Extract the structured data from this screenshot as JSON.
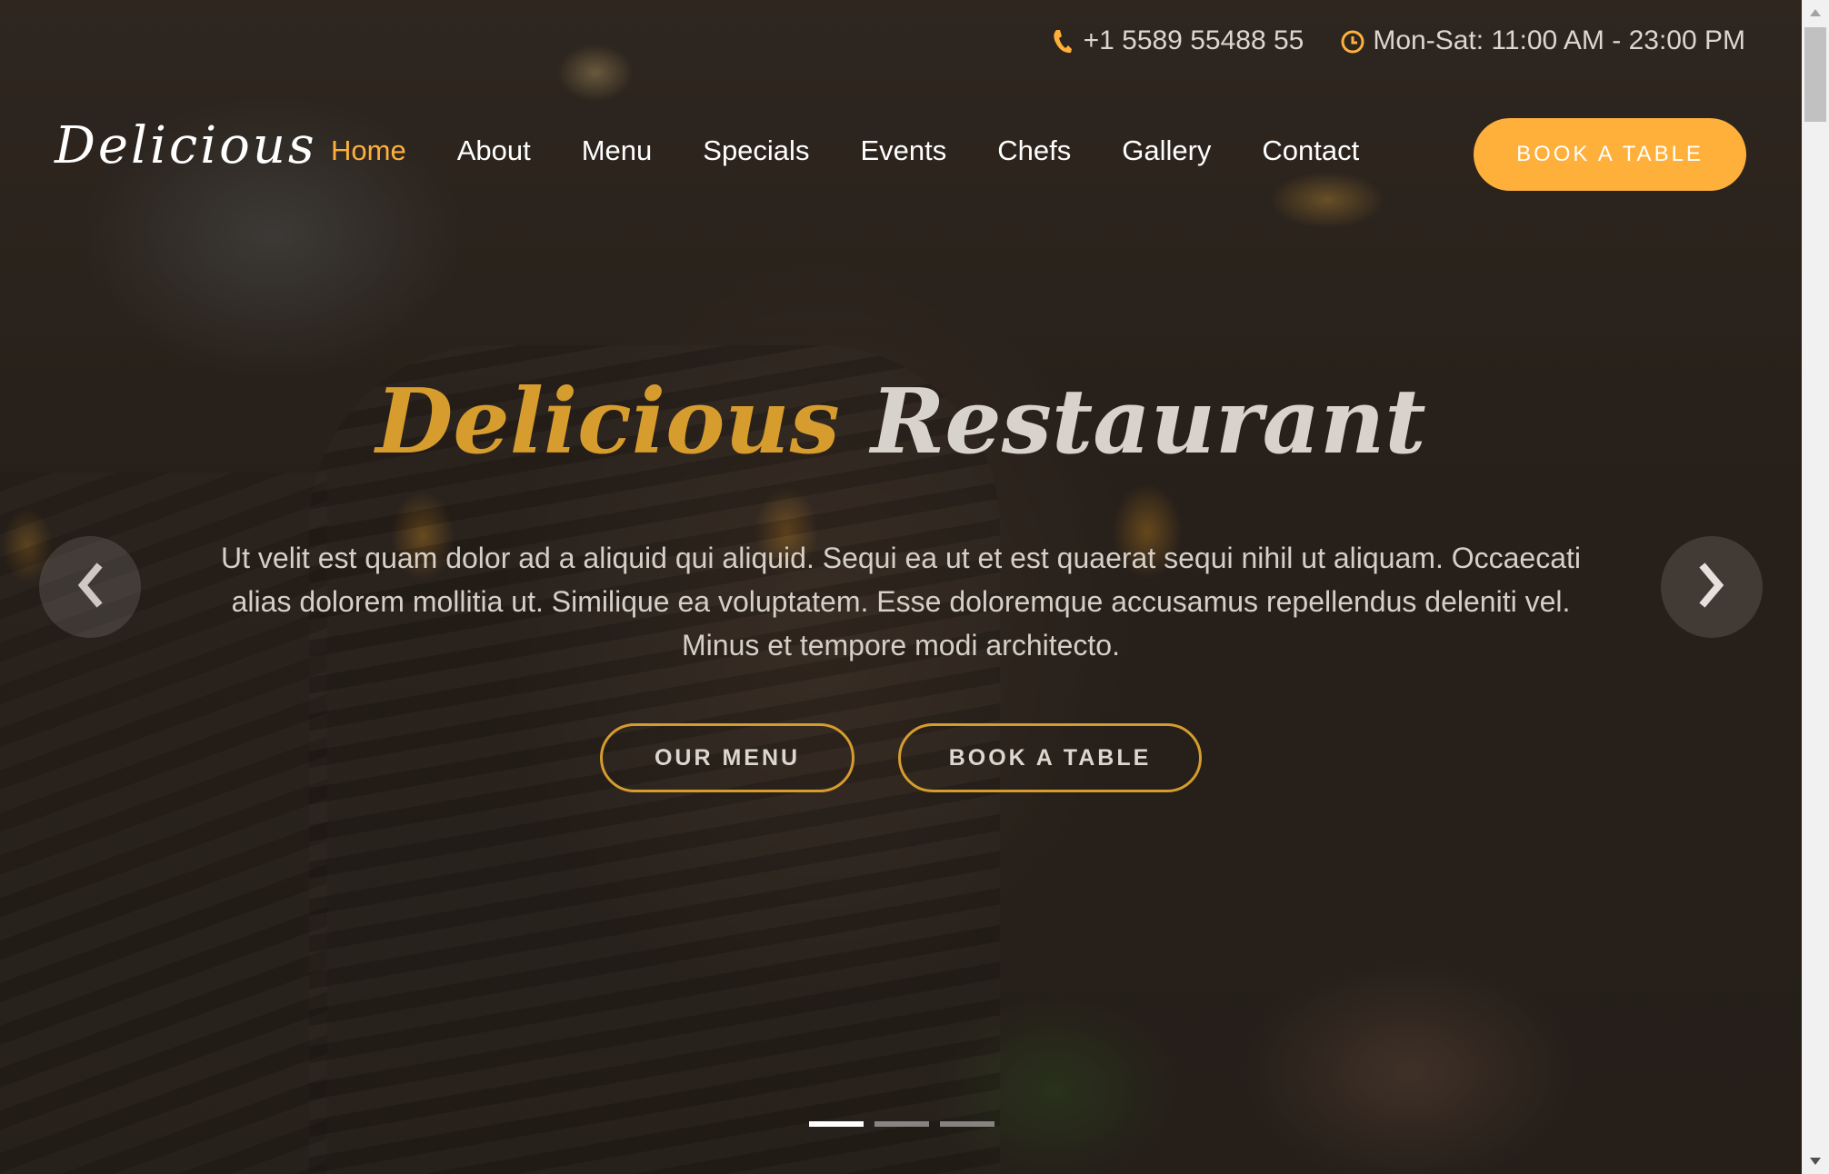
{
  "topbar": {
    "phone": "+1 5589 55488 55",
    "hours": "Mon-Sat: 11:00 AM - 23:00 PM",
    "phone_icon": "phone-icon",
    "clock_icon": "clock-icon"
  },
  "header": {
    "logo": "Delicious",
    "nav": [
      {
        "label": "Home",
        "active": true
      },
      {
        "label": "About"
      },
      {
        "label": "Menu"
      },
      {
        "label": "Specials"
      },
      {
        "label": "Events"
      },
      {
        "label": "Chefs"
      },
      {
        "label": "Gallery"
      },
      {
        "label": "Contact"
      }
    ],
    "cta_label": "BOOK A TABLE"
  },
  "hero": {
    "title_part1": "Delicious",
    "title_part2": "Restaurant",
    "text": "Ut velit est quam dolor ad a aliquid qui aliquid. Sequi ea ut et est quaerat sequi nihil ut aliquam. Occaecati alias dolorem mollitia ut. Similique ea voluptatem. Esse doloremque accusamus repellendus deleniti vel. Minus et tempore modi architecto.",
    "btn_menu": "OUR MENU",
    "btn_book": "BOOK A TABLE"
  },
  "carousel": {
    "slides": 3,
    "active_index": 0,
    "prev_icon": "chevron-left-icon",
    "next_icon": "chevron-right-icon"
  },
  "colors": {
    "accent": "#ffb03b",
    "title_gold": "#d69c2e"
  }
}
